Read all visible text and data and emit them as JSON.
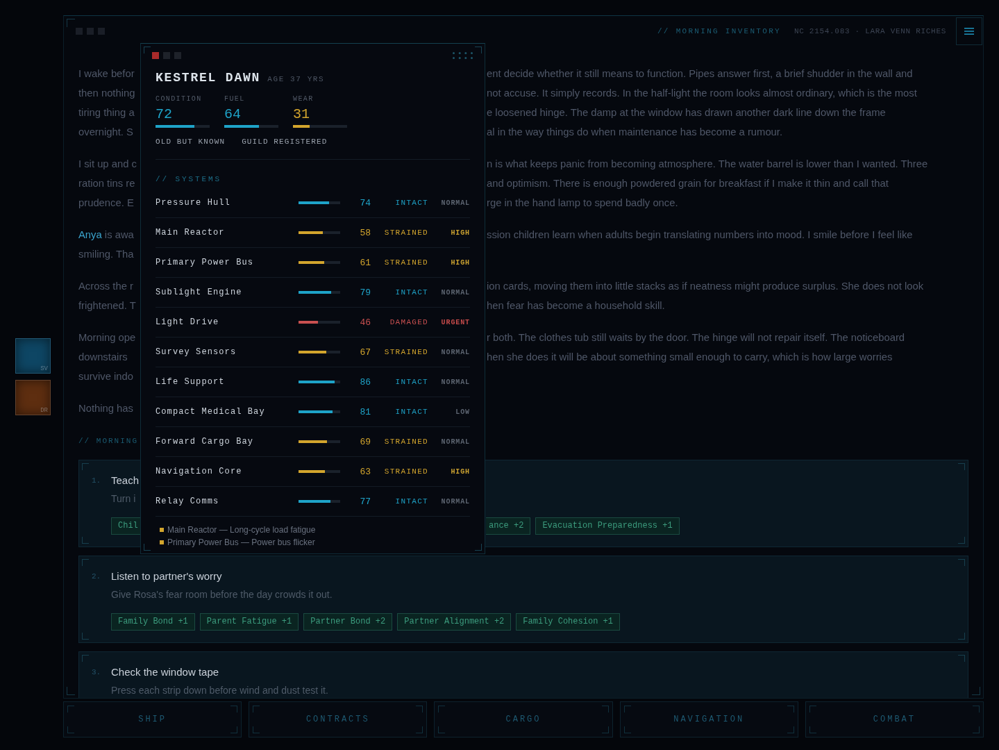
{
  "header": {
    "dots": [
      {
        "color": "#1a1e27"
      },
      {
        "color": "#1a1e27"
      },
      {
        "color": "#1a1e27"
      }
    ],
    "title": "// MORNING INVENTORY",
    "meta": "NC 2154.083 · LARA VENN RICHES"
  },
  "side_tiles": [
    {
      "label": "SV",
      "color": "#0e4664"
    },
    {
      "label": "DR",
      "color": "#5e2e10"
    }
  ],
  "story": {
    "paragraphs": [
      {
        "lines": [
          {
            "left": "I wake befor",
            "right": "ent decide whether it still means to function. Pipes answer first, a brief shudder in the wall and"
          },
          {
            "left": "then nothing",
            "right": "not accuse. It simply records. In the half-light the room looks almost ordinary, which is the most"
          },
          {
            "left": "tiring thing a",
            "right": "e loosened hinge. The damp at the window has drawn another dark line down the frame"
          },
          {
            "left": "overnight. S",
            "right": "al in the way things do when maintenance has become a rumour."
          }
        ]
      },
      {
        "lines": [
          {
            "left": "I sit up and c",
            "right": "n is what keeps panic from becoming atmosphere. The water barrel is lower than I wanted. Three"
          },
          {
            "left": "ration tins re",
            "right": "and optimism. There is enough powdered grain for breakfast if I make it thin and call that"
          },
          {
            "left": "prudence. E",
            "right": "rge in the hand lamp to spend badly once."
          }
        ]
      },
      {
        "lines": [
          {
            "highlight": "Anya",
            "left": "is awa",
            "right": "ssion children learn when adults begin translating numbers into mood. I smile before I feel like"
          },
          {
            "left": "smiling. Tha"
          }
        ]
      },
      {
        "lines": [
          {
            "left": "Across the r",
            "right": "ion cards, moving them into little stacks as if neatness might produce surplus. She does not look"
          },
          {
            "left": "frightened. T",
            "right": "hen fear has become a household skill."
          }
        ]
      },
      {
        "lines": [
          {
            "left": "Morning ope",
            "right": "r both. The clothes tub still waits by the door. The hinge will not repair itself. The noticeboard"
          },
          {
            "left": "downstairs",
            "right": "hen she does it will be about something small enough to carry, which is how large worries"
          },
          {
            "left": "survive indo"
          }
        ]
      },
      {
        "lines": [
          {
            "left": "Nothing has"
          }
        ]
      }
    ],
    "section_label": "// MORNING"
  },
  "tasks": [
    {
      "number": "1.",
      "title": "Teach",
      "description": "Turn i",
      "tags": [
        "Chil"
      ],
      "tags_after_panel": [
        "ance +2",
        "Evacuation Preparedness +1"
      ]
    },
    {
      "number": "2.",
      "title": "Listen to partner's worry",
      "description": "Give Rosa's fear room before the day crowds it out.",
      "tags": [
        "Family Bond +1",
        "Parent Fatigue +1",
        "Partner Bond +2",
        "Partner Alignment +2",
        "Family Cohesion +1"
      ]
    },
    {
      "number": "3.",
      "title": "Check the window tape",
      "description": "Press each strip down before wind and dust test it."
    }
  ],
  "character": {
    "dots": [
      {
        "color": "#a82a2a"
      },
      {
        "color": "#1e222a"
      },
      {
        "color": "#1e222a"
      }
    ],
    "name": "KESTREL DAWN",
    "age": "AGE 37 YRS",
    "stats": [
      {
        "label": "CONDITION",
        "value": "72",
        "level": 0.72,
        "color": "#1ea3c8"
      },
      {
        "label": "FUEL",
        "value": "64",
        "level": 0.64,
        "color": "#1ea3c8"
      },
      {
        "label": "WEAR",
        "value": "31",
        "level": 0.31,
        "color": "#d3a52d"
      }
    ],
    "traits": [
      "OLD BUT KNOWN",
      "GUILD REGISTERED"
    ],
    "systems_label": "// SYSTEMS",
    "systems": [
      {
        "name": "Pressure Hull",
        "level": 0.74,
        "value": "74",
        "status": "INTACT",
        "color": "#1ea3c8",
        "priority": {
          "label": "NORMAL",
          "color": "#5c6470"
        }
      },
      {
        "name": "Main Reactor",
        "level": 0.58,
        "value": "58",
        "status": "STRAINED",
        "color": "#d3a52d",
        "priority": {
          "label": "HIGH",
          "color": "#c9a030"
        }
      },
      {
        "name": "Primary Power Bus",
        "level": 0.61,
        "value": "61",
        "status": "STRAINED",
        "color": "#d3a52d",
        "priority": {
          "label": "HIGH",
          "color": "#c9a030"
        }
      },
      {
        "name": "Sublight Engine",
        "level": 0.79,
        "value": "79",
        "status": "INTACT",
        "color": "#1ea3c8",
        "priority": {
          "label": "NORMAL",
          "color": "#5c6470"
        }
      },
      {
        "name": "Light Drive",
        "level": 0.46,
        "value": "46",
        "status": "DAMAGED",
        "color": "#c95050",
        "priority": {
          "label": "URGENT",
          "color": "#c44a4a"
        }
      },
      {
        "name": "Survey Sensors",
        "level": 0.67,
        "value": "67",
        "status": "STRAINED",
        "color": "#d3a52d",
        "priority": {
          "label": "NORMAL",
          "color": "#5c6470"
        }
      },
      {
        "name": "Life Support",
        "level": 0.86,
        "value": "86",
        "status": "INTACT",
        "color": "#1ea3c8",
        "priority": {
          "label": "NORMAL",
          "color": "#5c6470"
        }
      },
      {
        "name": "Compact Medical Bay",
        "level": 0.81,
        "value": "81",
        "status": "INTACT",
        "color": "#1ea3c8",
        "priority": {
          "label": "LOW",
          "color": "#5c6470"
        }
      },
      {
        "name": "Forward Cargo Bay",
        "level": 0.69,
        "value": "69",
        "status": "STRAINED",
        "color": "#d3a52d",
        "priority": {
          "label": "NORMAL",
          "color": "#5c6470"
        }
      },
      {
        "name": "Navigation Core",
        "level": 0.63,
        "value": "63",
        "status": "STRAINED",
        "color": "#d3a52d",
        "priority": {
          "label": "HIGH",
          "color": "#c9a030"
        }
      },
      {
        "name": "Relay Comms",
        "level": 0.77,
        "value": "77",
        "status": "INTACT",
        "color": "#1ea3c8",
        "priority": {
          "label": "NORMAL",
          "color": "#5c6470"
        }
      }
    ],
    "notes": [
      {
        "text": "Main Reactor — Long-cycle load fatigue",
        "color": "#d3a52d"
      },
      {
        "text": "Primary Power Bus — Power bus flicker",
        "color": "#d3a52d"
      }
    ]
  },
  "nav": [
    {
      "label": "SHIP",
      "selected": false
    },
    {
      "label": "CONTRACTS",
      "selected": false
    },
    {
      "label": "CARGO",
      "selected": false
    },
    {
      "label": "NAVIGATION",
      "selected": false
    },
    {
      "label": "COMBAT",
      "selected": false
    }
  ]
}
